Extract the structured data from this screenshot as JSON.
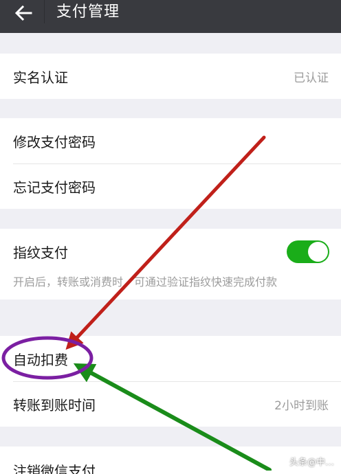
{
  "header": {
    "title": "支付管理"
  },
  "realname": {
    "label": "实名认证",
    "value": "已认证"
  },
  "password": {
    "change_label": "修改支付密码",
    "forgot_label": "忘记支付密码"
  },
  "fingerprint": {
    "label": "指纹支付",
    "enabled": true,
    "description": "开启后，转账或消费时，可通过验证指纹快速完成付款"
  },
  "payment": {
    "auto_deduct_label": "自动扣费",
    "transfer_label": "转账到账时间",
    "transfer_value": "2小时到账"
  },
  "cancel": {
    "label": "注销微信支付"
  },
  "colors": {
    "header": "#393a3f",
    "toggle_on": "#1aad19",
    "arrow_red": "#c0201a",
    "arrow_green": "#1a8c1a",
    "circle": "#7b1fa2"
  },
  "watermark": {
    "text": "头条@中…"
  }
}
